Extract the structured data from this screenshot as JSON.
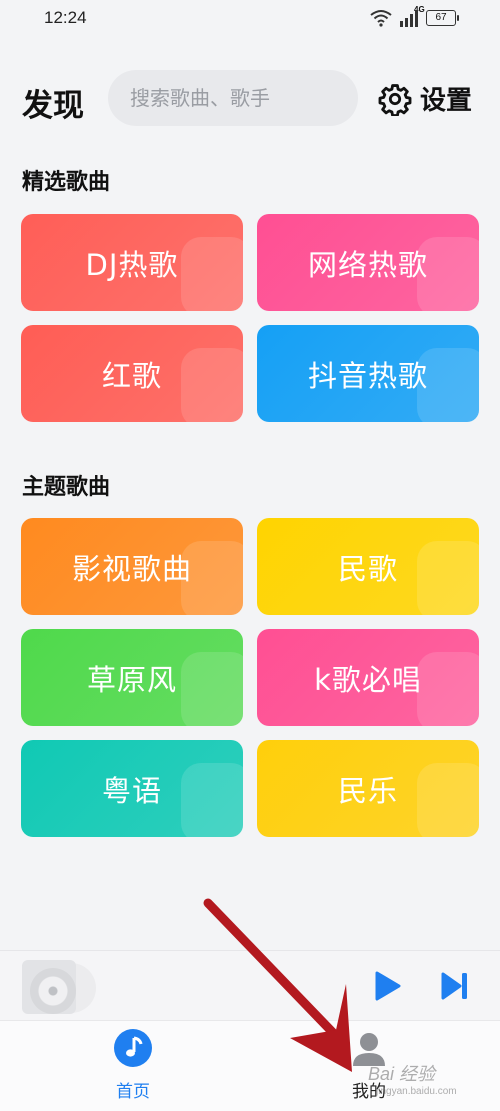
{
  "status_bar": {
    "time": "12:24",
    "network": "4G",
    "battery": "67"
  },
  "header": {
    "title": "发现",
    "search_placeholder": "搜索歌曲、歌手",
    "settings_label": "设置"
  },
  "sections": [
    {
      "title": "精选歌曲",
      "tiles": [
        {
          "label": "DJ热歌",
          "color": "#ff5e57"
        },
        {
          "label": "网络热歌",
          "color": "#ff4f93"
        },
        {
          "label": "红歌",
          "color": "#ff5d55"
        },
        {
          "label": "抖音热歌",
          "color": "#15a0f5"
        }
      ]
    },
    {
      "title": "主题歌曲",
      "tiles": [
        {
          "label": "影视歌曲",
          "color": "#ff8a1f"
        },
        {
          "label": "民歌",
          "color": "#ffd400"
        },
        {
          "label": "草原风",
          "color": "#4fd94b"
        },
        {
          "label": "k歌必唱",
          "color": "#ff4f93"
        },
        {
          "label": "粤语",
          "color": "#10c9b4"
        },
        {
          "label": "民乐",
          "color": "#ffcf0b"
        }
      ]
    }
  ],
  "player": {
    "play_icon": "play-icon",
    "next_icon": "skip-next-icon"
  },
  "bottom_nav": {
    "home_label": "首页",
    "mine_label": "我的"
  },
  "colors": {
    "accent": "#1f7ff0",
    "annotation_arrow": "#b3191f"
  },
  "watermark": {
    "text": "Bai 经验",
    "url": "jingyan.baidu.com"
  }
}
